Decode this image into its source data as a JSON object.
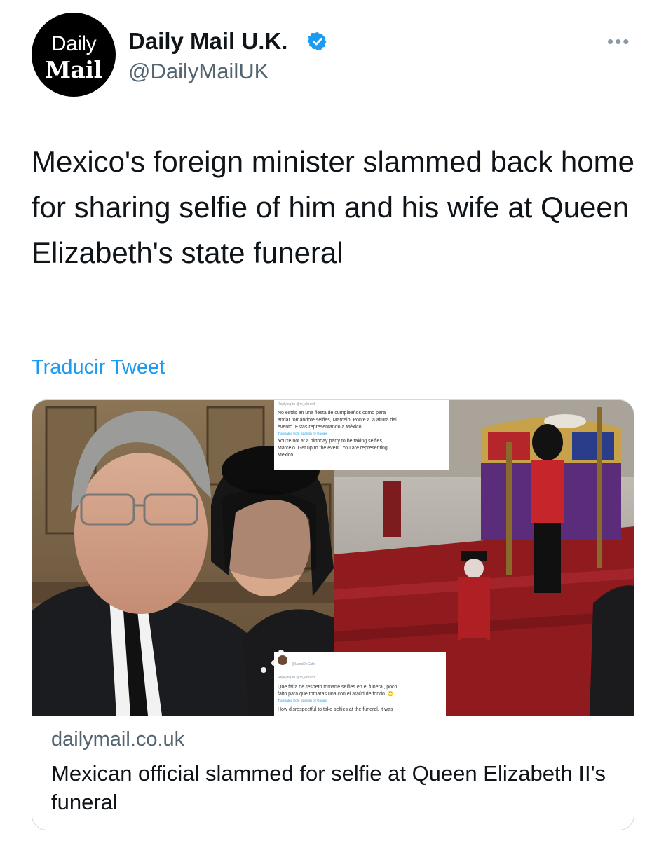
{
  "account": {
    "avatar_line1": "Daily",
    "avatar_line2": "Mail",
    "display_name": "Daily Mail U.K.",
    "handle": "@DailyMailUK"
  },
  "more_label": "•••",
  "tweet": {
    "text": "Mexico's foreign minister slammed back home for sharing selfie of him and his wife at Queen Elizabeth's state funeral",
    "translate_label": "Traducir Tweet"
  },
  "card": {
    "domain": "dailymail.co.uk",
    "title": "Mexican official slammed for selfie at Queen Elizabeth II's funeral",
    "screenshot_top": {
      "replying": "Replying to @m_ebrard",
      "spanish": [
        "No estás en una fiesta de cumpleaños como para",
        "andar tomándote selfies, Marcelo. Ponte a la altura del",
        "evento. Estás representando a México."
      ],
      "translated_note": "Translated from Spanish by Google",
      "english": [
        "You're not at a birthday party to be taking selfies,",
        "Marcelo. Get up to the event. You are representing",
        "Mexico."
      ]
    },
    "screenshot_bottom": {
      "user": "@LunaDeCafe",
      "replying": "Replying to @m_ebrard",
      "spanish": [
        "Que falta de respeto tomarte selfies en el funeral, poco",
        "falto para que tomaras una con el ataúd de fondo. 🙄"
      ],
      "translated_note": "Translated from Spanish by Google",
      "english": [
        "How disrespectful to take selfies at the funeral, it was"
      ]
    }
  },
  "colors": {
    "link_blue": "#1d9bf0",
    "secondary_text": "#536471",
    "verified_blue": "#1d9bf0",
    "border": "#cfd9de"
  },
  "icons": [
    "verified-badge-icon",
    "more-options-icon"
  ]
}
